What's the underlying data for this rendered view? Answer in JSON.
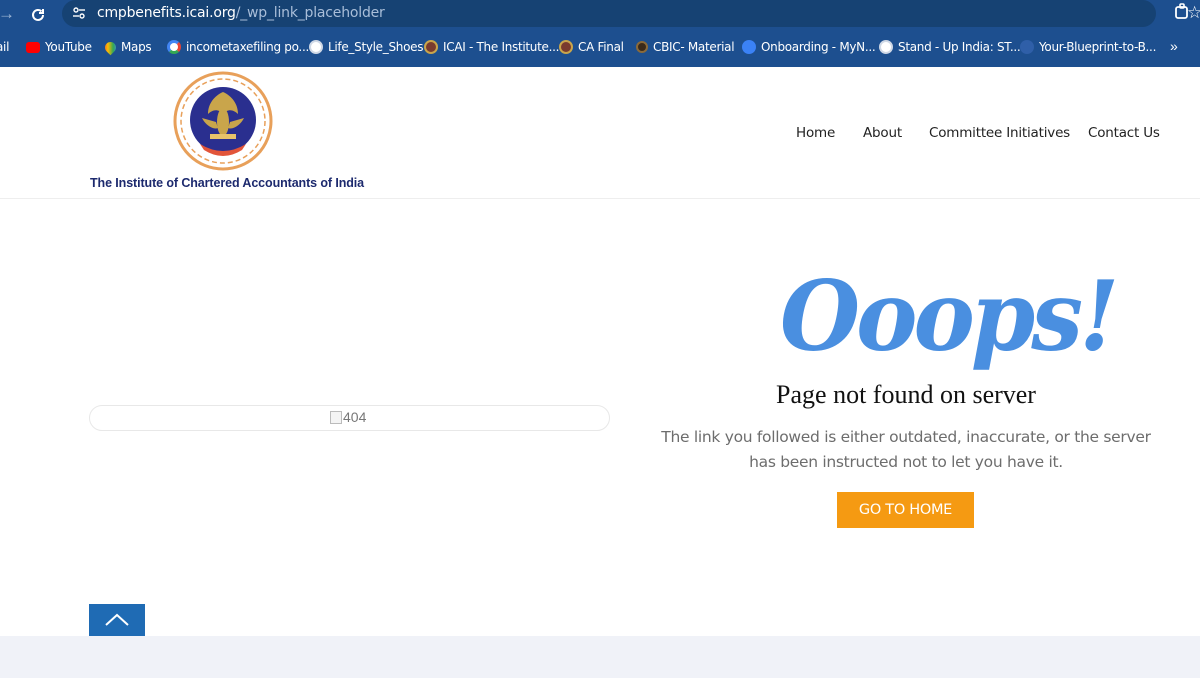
{
  "browser": {
    "url_host": "cmpbenefits.icai.org",
    "url_path": "/_wp_link_placeholder",
    "bookmarks": [
      {
        "label": "ail",
        "icon": "mail-icon",
        "color": "#1d4f8f"
      },
      {
        "label": "YouTube",
        "icon": "youtube-icon",
        "color": "#ff0000"
      },
      {
        "label": "Maps",
        "icon": "maps-icon",
        "color": "#34a853"
      },
      {
        "label": "incometaxefiling po...",
        "icon": "google-icon",
        "color": "#ffffff"
      },
      {
        "label": "Life_Style_Shoes",
        "icon": "globe-icon",
        "color": "#ffffff"
      },
      {
        "label": "ICAI - The Institute...",
        "icon": "icai-icon",
        "color": "#c9a54b"
      },
      {
        "label": "CA Final",
        "icon": "icai-icon",
        "color": "#c9a54b"
      },
      {
        "label": "CBIC- Material",
        "icon": "cbic-icon",
        "color": "#6b4b2b"
      },
      {
        "label": "Onboarding - MyN...",
        "icon": "gear-blue-icon",
        "color": "#3b82f6"
      },
      {
        "label": "Stand - Up India: ST...",
        "icon": "globe-icon",
        "color": "#ffffff"
      },
      {
        "label": "Your-Blueprint-to-B...",
        "icon": "blueprint-icon",
        "color": "#2f5fa8"
      }
    ]
  },
  "header": {
    "org_name": "The Institute of Chartered Accountants of India",
    "nav": [
      {
        "label": "Home"
      },
      {
        "label": "About"
      },
      {
        "label": "Committee Initiatives"
      },
      {
        "label": "Contact Us"
      }
    ]
  },
  "main": {
    "image_alt": "404",
    "headline": "Ooops!",
    "subtitle": "Page not found on server",
    "message": "The link you followed is either outdated, inaccurate, or the server has been instructed not to let you have it.",
    "button_label": "GO TO HOME"
  },
  "colors": {
    "chrome": "#1d4f8f",
    "headline": "#4a8fe0",
    "button": "#f59a12",
    "scroll_top": "#1f6bb4"
  }
}
